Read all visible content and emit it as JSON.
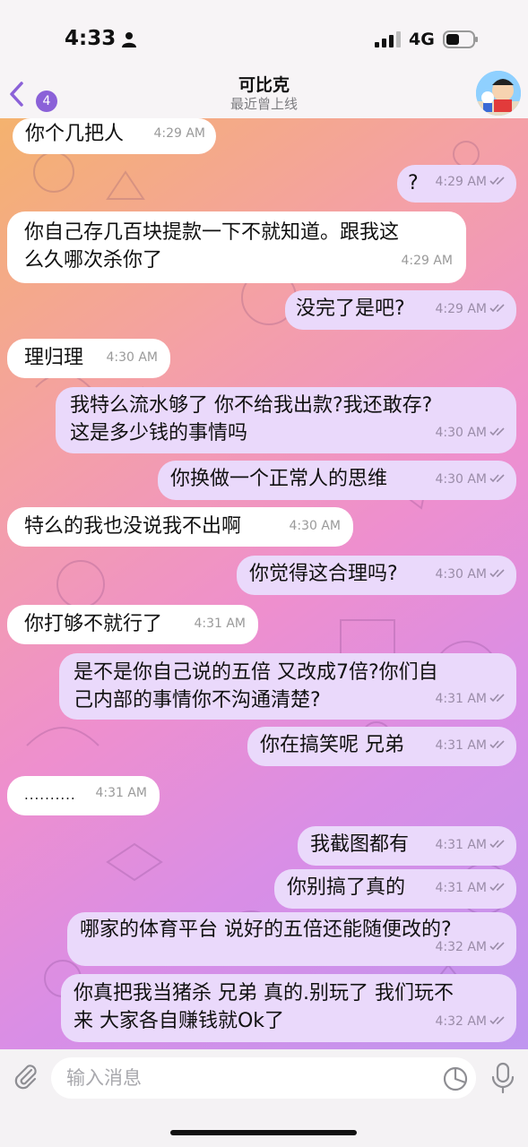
{
  "status_bar": {
    "time": "4:33",
    "network": "4G"
  },
  "header": {
    "back_count": "4",
    "title": "可比克",
    "subtitle": "最近曾上线"
  },
  "colors": {
    "accent": "#8b61d8",
    "outgoing_bubble": "#ead9fb",
    "incoming_bubble": "#ffffff"
  },
  "messages": [
    {
      "dir": "in",
      "text": "你个几把人",
      "time": "4:29 AM"
    },
    {
      "dir": "out",
      "text": "?",
      "time": "4:29 AM"
    },
    {
      "dir": "in",
      "text": "你自己存几百块提款一下不就知道。跟我这\n么久哪次杀你了",
      "time": "4:29 AM"
    },
    {
      "dir": "out",
      "text": "没完了是吧?",
      "time": "4:29 AM"
    },
    {
      "dir": "in",
      "text": "理归理",
      "time": "4:30 AM"
    },
    {
      "dir": "out",
      "text": "我特么流水够了 你不给我出款?我还敢存?\n这是多少钱的事情吗",
      "time": "4:30 AM"
    },
    {
      "dir": "out",
      "text": "你换做一个正常人的思维",
      "time": "4:30 AM"
    },
    {
      "dir": "in",
      "text": "特么的我也没说我不出啊",
      "time": "4:30 AM"
    },
    {
      "dir": "out",
      "text": "你觉得这合理吗?",
      "time": "4:30 AM"
    },
    {
      "dir": "in",
      "text": "你打够不就行了",
      "time": "4:31 AM"
    },
    {
      "dir": "out",
      "text": "是不是你自己说的五倍 又改成7倍?你们自\n己内部的事情你不沟通清楚?",
      "time": "4:31 AM"
    },
    {
      "dir": "out",
      "text": "你在搞笑呢 兄弟",
      "time": "4:31 AM"
    },
    {
      "dir": "in",
      "text": "..........",
      "time": "4:31 AM"
    },
    {
      "dir": "out",
      "text": "我截图都有",
      "time": "4:31 AM"
    },
    {
      "dir": "out",
      "text": "你别搞了真的",
      "time": "4:31 AM"
    },
    {
      "dir": "out",
      "text": "哪家的体育平台 说好的五倍还能随便改的?",
      "time": "4:32 AM"
    },
    {
      "dir": "out",
      "text": "你真把我当猪杀 兄弟 真的.别玩了 我们玩不\n来 大家各自赚钱就Ok了",
      "time": "4:32 AM"
    }
  ],
  "input": {
    "placeholder": "输入消息"
  }
}
